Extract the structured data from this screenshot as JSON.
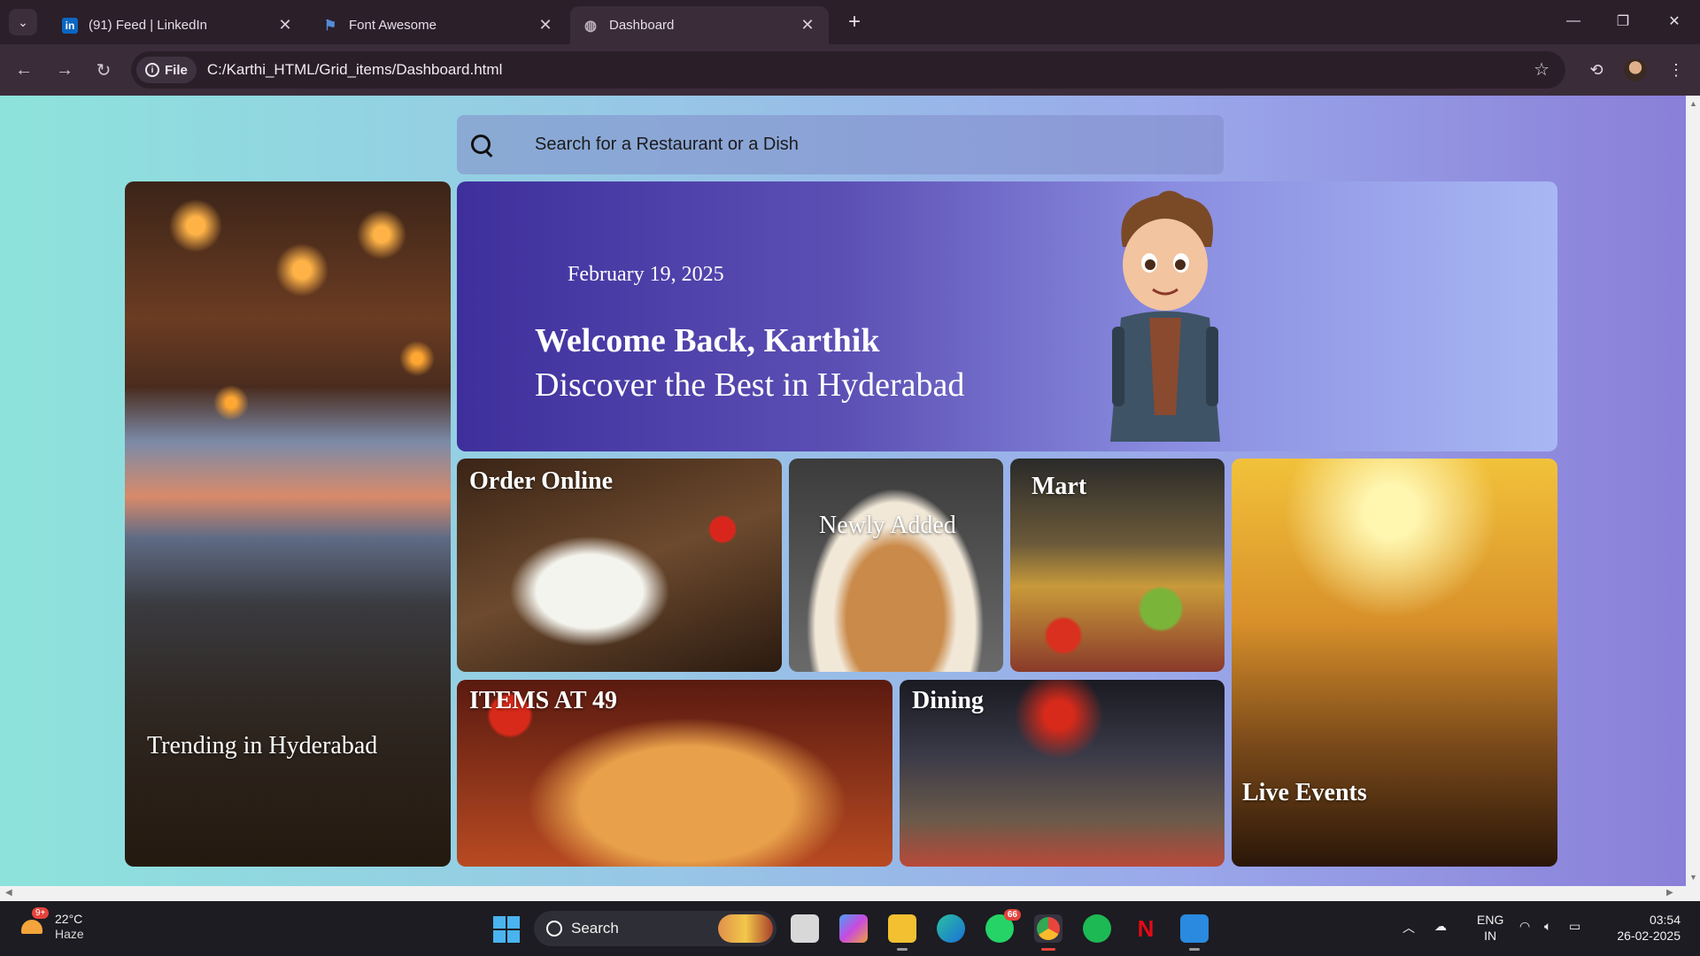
{
  "browser": {
    "tabs": [
      {
        "title": "(91) Feed | LinkedIn",
        "favicon": "linkedin-icon",
        "favicon_color": "#0a66c2"
      },
      {
        "title": "Font Awesome",
        "favicon": "flag-icon",
        "favicon_color": "#538dd7"
      },
      {
        "title": "Dashboard",
        "favicon": "globe-icon",
        "favicon_color": "#bdb3bd",
        "active": true
      }
    ],
    "file_chip": "File",
    "url": "C:/Karthi_HTML/Grid_items/Dashboard.html"
  },
  "page": {
    "search_placeholder": "Search for a Restaurant or a Dish",
    "welcome": {
      "date": "February 19, 2025",
      "greeting": "Welcome Back, Karthik",
      "tagline": "Discover the Best in Hyderabad"
    },
    "cards": {
      "trending": "Trending in Hyderabad",
      "order_online": "Order Online",
      "newly_added": "Newly Added",
      "mart": "Mart",
      "live_events": "Live Events",
      "items_at_49": "ITEMS AT 49",
      "dining": "Dining"
    },
    "background_colors": [
      "#8de3dc",
      "#9aa8ea",
      "#8a7fd9"
    ]
  },
  "taskbar": {
    "weather_temp": "22°C",
    "weather_condition": "Haze",
    "weather_badge": "9+",
    "search_label": "Search",
    "whatsapp_badge": "66",
    "language_top": "ENG",
    "language_bottom": "IN",
    "time": "03:54",
    "date": "26-02-2025"
  }
}
